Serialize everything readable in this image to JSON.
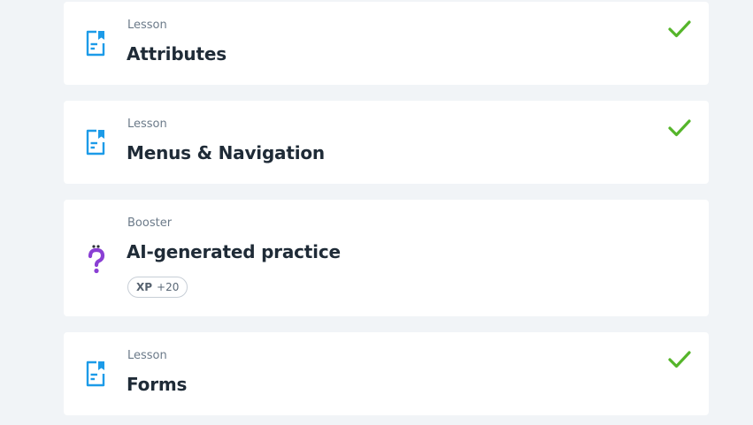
{
  "colors": {
    "page_background": "#f1f4f7",
    "card_background": "#ffffff",
    "lesson_icon": "#1c9be8",
    "booster_icon": "#8a3fd4",
    "check": "#55b52a",
    "title_text": "#1f2b37",
    "kind_text": "#6b7a89"
  },
  "items": [
    {
      "kind": "Lesson",
      "title": "Attributes",
      "icon": "lesson-document-icon",
      "completed": true
    },
    {
      "kind": "Lesson",
      "title": "Menus & Navigation",
      "icon": "lesson-document-icon",
      "completed": true
    },
    {
      "kind": "Booster",
      "title": "AI-generated practice",
      "icon": "question-mark-icon",
      "completed": false,
      "xp_badge": {
        "label": "XP",
        "value": "+20"
      }
    },
    {
      "kind": "Lesson",
      "title": "Forms",
      "icon": "lesson-document-icon",
      "completed": true
    }
  ]
}
